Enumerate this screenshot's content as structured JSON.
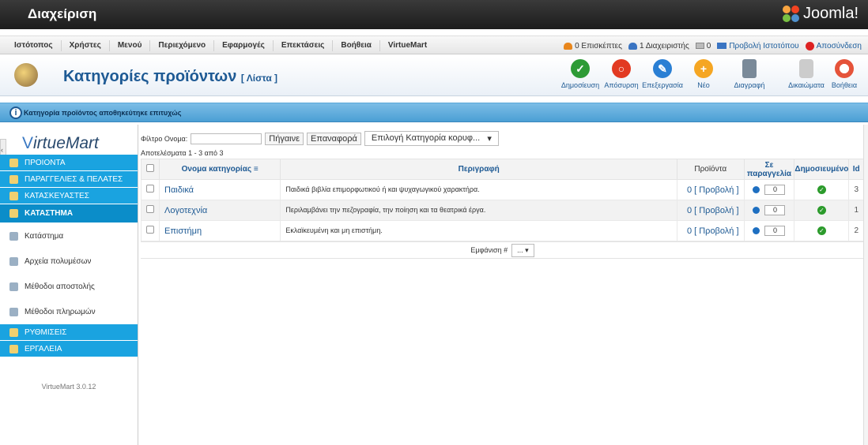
{
  "header": {
    "title": "Διαχείριση",
    "brand": "Joomla!"
  },
  "menu": {
    "items": [
      "Ιστότοπος",
      "Χρήστες",
      "Μενού",
      "Περιεχόμενο",
      "Εφαρμογές",
      "Επεκτάσεις",
      "Βοήθεια",
      "VirtueMart"
    ],
    "status": {
      "visitors": "0 Επισκέπτες",
      "admins": "1 Διαχειριστής",
      "messages": "0",
      "view_site": "Προβολή Ιστοτόπου",
      "logout": "Αποσύνδεση"
    }
  },
  "toolbar": {
    "title": "Κατηγορίες προϊόντων",
    "subtitle": "[ Λίστα ]",
    "buttons": {
      "publish": "Δημοσίευση",
      "unpublish": "Απόσυρση",
      "edit": "Επεξεργασία",
      "new": "Νέο",
      "delete": "Διαγραφή",
      "permissions": "Δικαιώματα",
      "help": "Βοήθεια"
    }
  },
  "message": {
    "text": "Κατηγορία προϊόντος αποθηκεύτηκε επιτυχώς"
  },
  "sidebar": {
    "logo_pre": "V",
    "logo_main": "irtueMart",
    "sections": {
      "products": "ΠΡΟΙΟΝΤΑ",
      "orders": "ΠΑΡΑΓΓΕΛΙΕΣ & ΠΕΛΑΤΕΣ",
      "manufacturers": "ΚΑΤΑΣΚΕΥΑΣΤΕΣ",
      "shop": "ΚΑΤΑΣΤΗΜΑ",
      "settings": "ΡΥΘΜΙΣΕΙΣ",
      "tools": "ΕΡΓΑΛΕΙΑ"
    },
    "sub": {
      "store": "Κατάστημα",
      "media": "Αρχεία πολυμέσων",
      "shipment": "Μέθοδοι αποστολής",
      "payment": "Μέθοδοι πληρωμών"
    },
    "version": "VirtueMart 3.0.12"
  },
  "filter": {
    "label": "Φίλτρο Ονομα:",
    "go": "Πήγαινε",
    "reset": "Επαναφορά",
    "select": "Επιλογή Κατηγορία κορυφ...",
    "results": "Αποτελέσματα 1 - 3 από 3"
  },
  "table": {
    "headers": {
      "name": "Ονομα κατηγορίας",
      "description": "Περιγραφή",
      "products": "Προϊόντα",
      "ordering": "Σε παραγγελία",
      "published": "Δημοσιευμένο",
      "id": "Id"
    },
    "rows": [
      {
        "name": "Παιδικά",
        "description": "Παιδικά βιβλία επιμορφωτικού ή και ψυχαγωγικού χαρακτήρα.",
        "products": "0 [ Προβολή ]",
        "order": "0",
        "id": "3"
      },
      {
        "name": "Λογοτεχνία",
        "description": "Περιλαμβάνει την πεζογραφία, την ποίηση και τα θεατρικά έργα.",
        "products": "0 [ Προβολή ]",
        "order": "0",
        "id": "1"
      },
      {
        "name": "Επιστήμη",
        "description": "Εκλαϊκευμένη και μη επιστήμη.",
        "products": "0 [ Προβολή ]",
        "order": "0",
        "id": "2"
      }
    ]
  },
  "pager": {
    "label": "Εμφάνιση #",
    "value": "..."
  },
  "colors": {
    "accent": "#1aa3e0",
    "title": "#1e5a94",
    "message_bar": "#5aa7d8"
  }
}
